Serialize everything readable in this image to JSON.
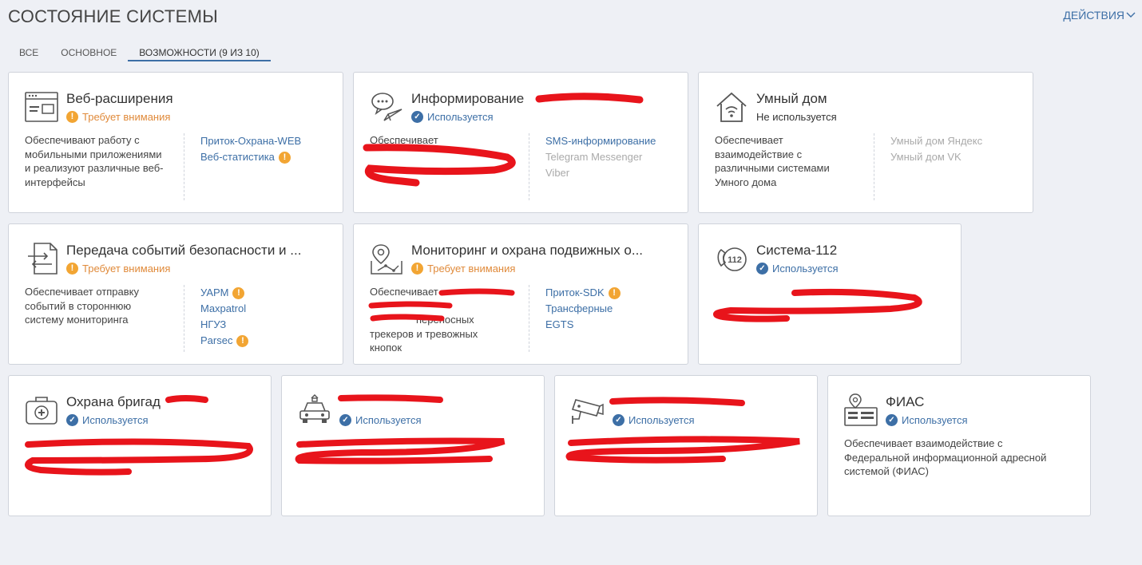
{
  "header": {
    "title": "СОСТОЯНИЕ СИСТЕМЫ",
    "actions_label": "ДЕЙСТВИЯ"
  },
  "tabs": [
    {
      "label": "ВСЕ"
    },
    {
      "label": "ОСНОВНОЕ"
    },
    {
      "label": "ВОЗМОЖНОСТИ (9 ИЗ 10)"
    }
  ],
  "statuses": {
    "warn": "Требует внимания",
    "ok": "Используется",
    "off": "Не используется"
  },
  "cards": {
    "web": {
      "title": "Веб-расширения",
      "icon": "browser-window-icon",
      "desc": [
        "Обеспечивают работу с",
        "мобильными приложениями",
        "и реализуют различные веб-",
        "интерфейсы"
      ],
      "links": [
        "Приток-Охрана-WEB",
        "Веб-статистика"
      ]
    },
    "inform": {
      "title": "Информирование",
      "icon": "chat-bubbles-icon",
      "desc": [
        "Обеспечивает",
        "",
        "",
        ""
      ],
      "links": [
        "SMS-информирование",
        "Telegram Messenger",
        "Viber"
      ]
    },
    "smarthome": {
      "title": "Умный дом",
      "icon": "smart-home-icon",
      "desc": [
        "Обеспечивает",
        "взаимодействие с",
        "различными системами",
        "Умного дома"
      ],
      "links": [
        "Умный дом Яндекс",
        "Умный дом VK"
      ]
    },
    "transfer": {
      "title": "Передача событий безопасности и ...",
      "icon": "transfer-arrows-icon",
      "desc": [
        "Обеспечивает отправку",
        "событий в стороннюю",
        "систему мониторинга"
      ],
      "links": [
        "УАРМ",
        "Maxpatrol",
        "НГУЗ",
        "Parsec"
      ]
    },
    "mobile": {
      "title": "Мониторинг и охрана подвижных о...",
      "icon": "map-route-icon",
      "desc": [
        "Обеспечивает",
        "",
        "переносных",
        "трекеров и тревожных",
        "кнопок"
      ],
      "links": [
        "Приток-SDK",
        "Трансферные",
        "EGTS"
      ]
    },
    "s112": {
      "title": "Система-112",
      "icon": "phone-112-icon",
      "icon_text": "112",
      "desc": [
        "",
        "",
        ""
      ]
    },
    "ambulance": {
      "title": "Охрана бригад",
      "icon": "first-aid-kit-icon",
      "desc": [
        "",
        "",
        ""
      ]
    },
    "patrol": {
      "title": "",
      "icon": "police-car-icon",
      "desc": [
        "",
        ""
      ]
    },
    "video": {
      "title": "",
      "icon": "cctv-camera-icon",
      "desc": [
        "",
        ""
      ]
    },
    "fias": {
      "title": "ФИАС",
      "icon": "address-card-icon",
      "desc": [
        "Обеспечивает взаимодействие с",
        "Федеральной информационной адресной",
        "системой (ФИАС)"
      ]
    }
  },
  "colors": {
    "accent": "#3d6fa6",
    "warning": "#f2a533",
    "warning_text": "#e08a3a",
    "redaction": "#e8141b",
    "background": "#eef0f5"
  }
}
